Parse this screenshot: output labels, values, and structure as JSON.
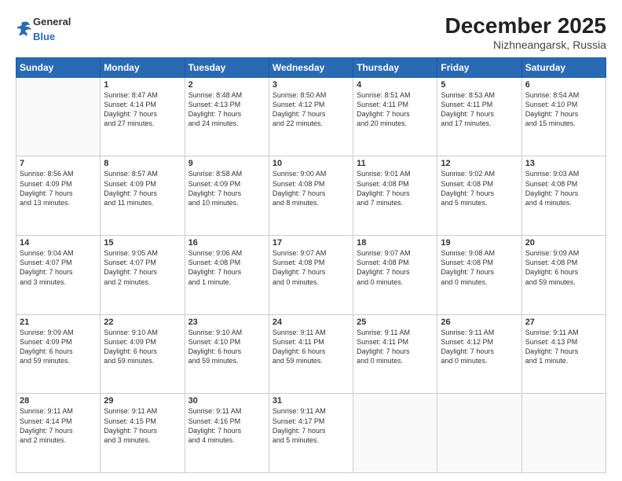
{
  "logo": {
    "general": "General",
    "blue": "Blue"
  },
  "header": {
    "month": "December 2025",
    "location": "Nizhneangarsk, Russia"
  },
  "weekdays": [
    "Sunday",
    "Monday",
    "Tuesday",
    "Wednesday",
    "Thursday",
    "Friday",
    "Saturday"
  ],
  "weeks": [
    [
      {
        "day": "",
        "info": ""
      },
      {
        "day": "1",
        "info": "Sunrise: 8:47 AM\nSunset: 4:14 PM\nDaylight: 7 hours\nand 27 minutes."
      },
      {
        "day": "2",
        "info": "Sunrise: 8:48 AM\nSunset: 4:13 PM\nDaylight: 7 hours\nand 24 minutes."
      },
      {
        "day": "3",
        "info": "Sunrise: 8:50 AM\nSunset: 4:12 PM\nDaylight: 7 hours\nand 22 minutes."
      },
      {
        "day": "4",
        "info": "Sunrise: 8:51 AM\nSunset: 4:11 PM\nDaylight: 7 hours\nand 20 minutes."
      },
      {
        "day": "5",
        "info": "Sunrise: 8:53 AM\nSunset: 4:11 PM\nDaylight: 7 hours\nand 17 minutes."
      },
      {
        "day": "6",
        "info": "Sunrise: 8:54 AM\nSunset: 4:10 PM\nDaylight: 7 hours\nand 15 minutes."
      }
    ],
    [
      {
        "day": "7",
        "info": "Sunrise: 8:56 AM\nSunset: 4:09 PM\nDaylight: 7 hours\nand 13 minutes."
      },
      {
        "day": "8",
        "info": "Sunrise: 8:57 AM\nSunset: 4:09 PM\nDaylight: 7 hours\nand 11 minutes."
      },
      {
        "day": "9",
        "info": "Sunrise: 8:58 AM\nSunset: 4:09 PM\nDaylight: 7 hours\nand 10 minutes."
      },
      {
        "day": "10",
        "info": "Sunrise: 9:00 AM\nSunset: 4:08 PM\nDaylight: 7 hours\nand 8 minutes."
      },
      {
        "day": "11",
        "info": "Sunrise: 9:01 AM\nSunset: 4:08 PM\nDaylight: 7 hours\nand 7 minutes."
      },
      {
        "day": "12",
        "info": "Sunrise: 9:02 AM\nSunset: 4:08 PM\nDaylight: 7 hours\nand 5 minutes."
      },
      {
        "day": "13",
        "info": "Sunrise: 9:03 AM\nSunset: 4:08 PM\nDaylight: 7 hours\nand 4 minutes."
      }
    ],
    [
      {
        "day": "14",
        "info": "Sunrise: 9:04 AM\nSunset: 4:07 PM\nDaylight: 7 hours\nand 3 minutes."
      },
      {
        "day": "15",
        "info": "Sunrise: 9:05 AM\nSunset: 4:07 PM\nDaylight: 7 hours\nand 2 minutes."
      },
      {
        "day": "16",
        "info": "Sunrise: 9:06 AM\nSunset: 4:08 PM\nDaylight: 7 hours\nand 1 minute."
      },
      {
        "day": "17",
        "info": "Sunrise: 9:07 AM\nSunset: 4:08 PM\nDaylight: 7 hours\nand 0 minutes."
      },
      {
        "day": "18",
        "info": "Sunrise: 9:07 AM\nSunset: 4:08 PM\nDaylight: 7 hours\nand 0 minutes."
      },
      {
        "day": "19",
        "info": "Sunrise: 9:08 AM\nSunset: 4:08 PM\nDaylight: 7 hours\nand 0 minutes."
      },
      {
        "day": "20",
        "info": "Sunrise: 9:09 AM\nSunset: 4:08 PM\nDaylight: 6 hours\nand 59 minutes."
      }
    ],
    [
      {
        "day": "21",
        "info": "Sunrise: 9:09 AM\nSunset: 4:09 PM\nDaylight: 6 hours\nand 59 minutes."
      },
      {
        "day": "22",
        "info": "Sunrise: 9:10 AM\nSunset: 4:09 PM\nDaylight: 6 hours\nand 59 minutes."
      },
      {
        "day": "23",
        "info": "Sunrise: 9:10 AM\nSunset: 4:10 PM\nDaylight: 6 hours\nand 59 minutes."
      },
      {
        "day": "24",
        "info": "Sunrise: 9:11 AM\nSunset: 4:11 PM\nDaylight: 6 hours\nand 59 minutes."
      },
      {
        "day": "25",
        "info": "Sunrise: 9:11 AM\nSunset: 4:11 PM\nDaylight: 7 hours\nand 0 minutes."
      },
      {
        "day": "26",
        "info": "Sunrise: 9:11 AM\nSunset: 4:12 PM\nDaylight: 7 hours\nand 0 minutes."
      },
      {
        "day": "27",
        "info": "Sunrise: 9:11 AM\nSunset: 4:13 PM\nDaylight: 7 hours\nand 1 minute."
      }
    ],
    [
      {
        "day": "28",
        "info": "Sunrise: 9:11 AM\nSunset: 4:14 PM\nDaylight: 7 hours\nand 2 minutes."
      },
      {
        "day": "29",
        "info": "Sunrise: 9:11 AM\nSunset: 4:15 PM\nDaylight: 7 hours\nand 3 minutes."
      },
      {
        "day": "30",
        "info": "Sunrise: 9:11 AM\nSunset: 4:16 PM\nDaylight: 7 hours\nand 4 minutes."
      },
      {
        "day": "31",
        "info": "Sunrise: 9:11 AM\nSunset: 4:17 PM\nDaylight: 7 hours\nand 5 minutes."
      },
      {
        "day": "",
        "info": ""
      },
      {
        "day": "",
        "info": ""
      },
      {
        "day": "",
        "info": ""
      }
    ]
  ]
}
